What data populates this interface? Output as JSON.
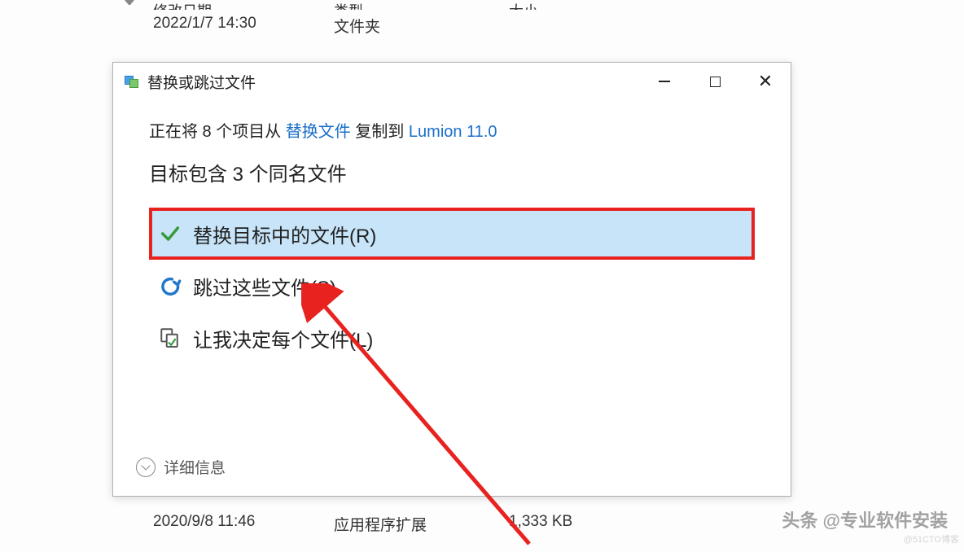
{
  "explorer": {
    "headers": {
      "date": "修改日期",
      "type": "类型",
      "size": "大小"
    },
    "row_top": {
      "date": "2022/1/7 14:30",
      "type": "文件夹",
      "size": ""
    },
    "row_bottom": {
      "date": "2020/9/8 11:46",
      "type": "应用程序扩展",
      "size": "1,333 KB"
    }
  },
  "dialog": {
    "title": "替换或跳过文件",
    "copy_prefix": "正在将 8 个项目从 ",
    "copy_source": "替换文件",
    "copy_middle": " 复制到 ",
    "copy_target": "Lumion 11.0",
    "conflict_heading": "目标包含 3 个同名文件",
    "option_replace": "替换目标中的文件(R)",
    "option_skip": "跳过这些文件(S)",
    "option_decide": "让我决定每个文件(L)",
    "details": "详细信息"
  },
  "watermark": {
    "toutiao": "头条 @专业软件安装",
    "cto": "@51CTO博客"
  }
}
